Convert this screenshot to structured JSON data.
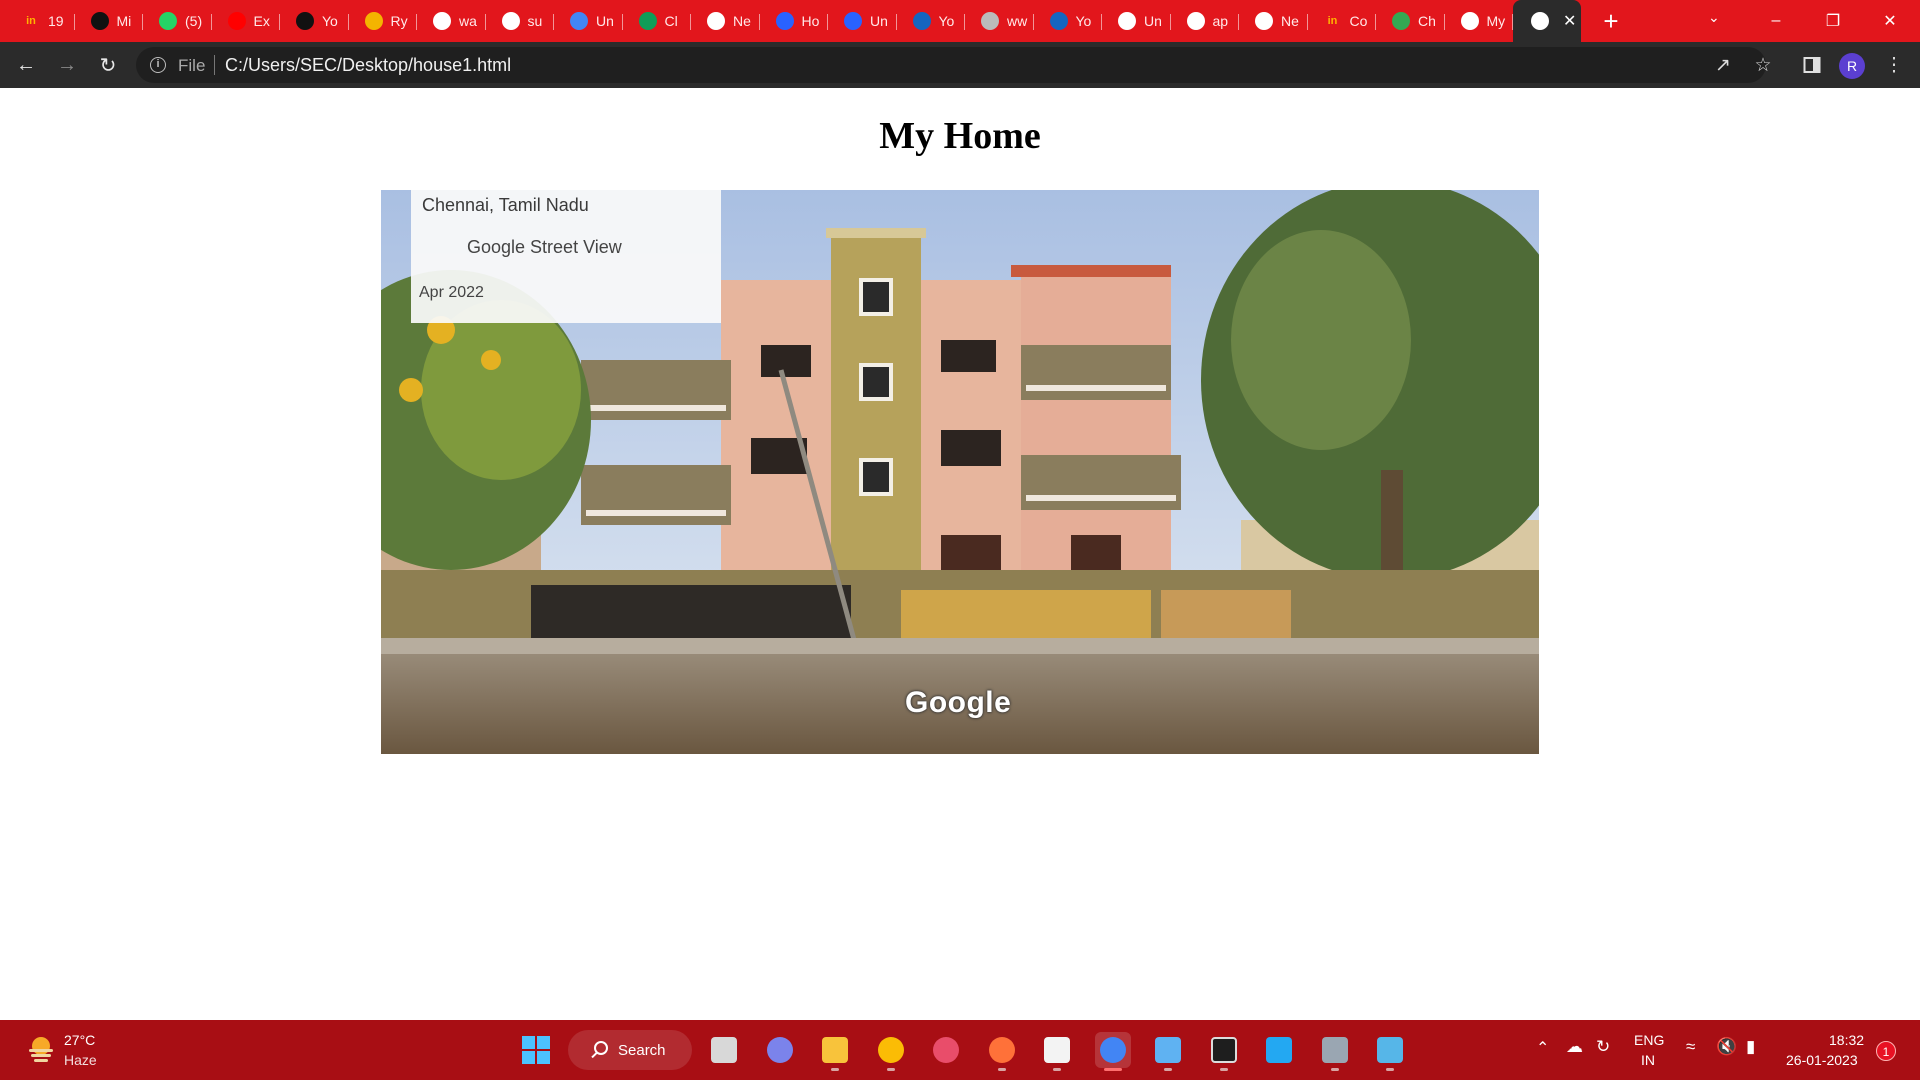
{
  "browser": {
    "tabs": [
      {
        "label": "19",
        "favicon": "in",
        "favicon_color": "#ffb300"
      },
      {
        "label": "Mi",
        "favicon": "github-icon",
        "favicon_color": "#111111"
      },
      {
        "label": "(5)",
        "favicon": "whatsapp-icon",
        "favicon_color": "#25d366"
      },
      {
        "label": "Ex",
        "favicon": "youtube-icon",
        "favicon_color": "#ff0000"
      },
      {
        "label": "Yo",
        "favicon": "github-icon",
        "favicon_color": "#111111"
      },
      {
        "label": "Ry",
        "favicon": "cloud-icon",
        "favicon_color": "#f4b400"
      },
      {
        "label": "wa",
        "favicon": "google-icon",
        "favicon_color": "#ffffff"
      },
      {
        "label": "su",
        "favicon": "google-icon",
        "favicon_color": "#ffffff"
      },
      {
        "label": "Un",
        "favicon": "docs-icon",
        "favicon_color": "#4285f4"
      },
      {
        "label": "Cl",
        "favicon": "drive-icon",
        "favicon_color": "#0f9d58"
      },
      {
        "label": "Ne",
        "favicon": "chrome-icon",
        "favicon_color": "#ffffff"
      },
      {
        "label": "Ho",
        "favicon": "c-icon",
        "favicon_color": "#2962ff"
      },
      {
        "label": "Un",
        "favicon": "c-icon",
        "favicon_color": "#2962ff"
      },
      {
        "label": "Yo",
        "favicon": "s-icon",
        "favicon_color": "#1565c0"
      },
      {
        "label": "ww",
        "favicon": "globe-icon",
        "favicon_color": "#bbbbbb"
      },
      {
        "label": "Yo",
        "favicon": "s-icon",
        "favicon_color": "#1565c0"
      },
      {
        "label": "Un",
        "favicon": "globe-icon",
        "favicon_color": "#ffffff"
      },
      {
        "label": "ap",
        "favicon": "google-icon",
        "favicon_color": "#ffffff"
      },
      {
        "label": "Ne",
        "favicon": "chrome-icon",
        "favicon_color": "#ffffff"
      },
      {
        "label": "Co",
        "favicon": "in",
        "favicon_color": "#ffb300"
      },
      {
        "label": "Ch",
        "favicon": "maps-icon",
        "favicon_color": "#34a853"
      },
      {
        "label": "My",
        "favicon": "globe-icon",
        "favicon_color": "#ffffff"
      }
    ],
    "active_tab": {
      "favicon": "globe-icon",
      "close": "✕"
    },
    "new_tab_label": "+",
    "address": {
      "scheme_label": "File",
      "url": "C:/Users/SEC/Desktop/house1.html"
    },
    "profile_initial": "R",
    "colors": {
      "tabstrip": "#e2161c",
      "toolbar": "#2b2b2b"
    }
  },
  "page": {
    "title": "My Home",
    "street_view": {
      "location": "Chennai, Tamil Nadu",
      "source": "Google Street View",
      "date": "Apr 2022",
      "watermark": "Google"
    }
  },
  "taskbar": {
    "weather": {
      "temp": "27°C",
      "condition": "Haze"
    },
    "search_label": "Search",
    "apps": [
      "task-view-icon",
      "teams-icon",
      "file-explorer-icon",
      "chrome-icon",
      "photos-icon",
      "firefox-icon",
      "editor-icon",
      "chrome-profile-icon",
      "notepad-icon",
      "terminal-icon",
      "vscode-icon",
      "settings-icon",
      "paint-icon"
    ],
    "language": {
      "line1": "ENG",
      "line2": "IN"
    },
    "clock": {
      "time": "18:32",
      "date": "26-01-2023"
    },
    "notification_count": "1",
    "color": "#a80e14"
  }
}
